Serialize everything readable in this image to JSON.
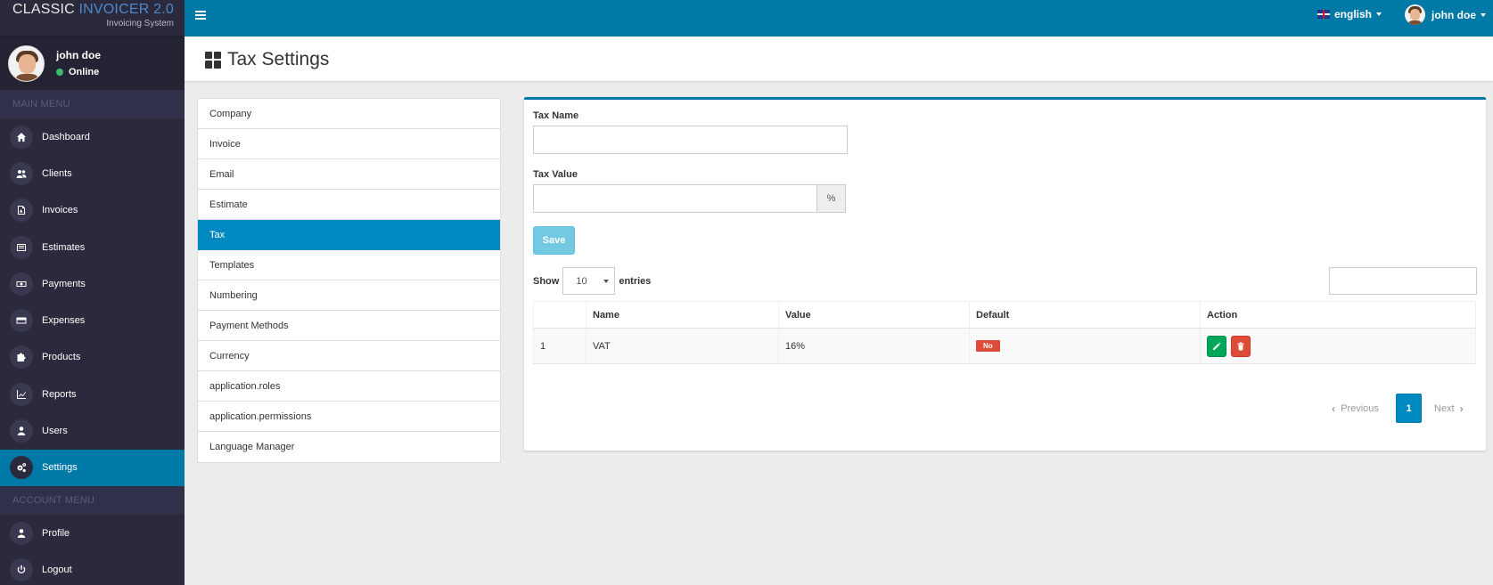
{
  "brand": {
    "title_plain": "CLASSIC ",
    "title_accent": "INVOICER 2.0",
    "subtitle": "Invoicing System"
  },
  "user": {
    "name": "john doe",
    "status": "Online"
  },
  "sidebar": {
    "main_menu_header": "MAIN MENU",
    "account_menu_header": "ACCOUNT MENU",
    "items": [
      {
        "label": "Dashboard",
        "icon": "home-icon"
      },
      {
        "label": "Clients",
        "icon": "users-icon"
      },
      {
        "label": "Invoices",
        "icon": "file-pdf-icon"
      },
      {
        "label": "Estimates",
        "icon": "list-icon"
      },
      {
        "label": "Payments",
        "icon": "money-icon"
      },
      {
        "label": "Expenses",
        "icon": "credit-card-icon"
      },
      {
        "label": "Products",
        "icon": "puzzle-icon"
      },
      {
        "label": "Reports",
        "icon": "line-chart-icon"
      },
      {
        "label": "Users",
        "icon": "user-icon"
      },
      {
        "label": "Settings",
        "icon": "cogs-icon",
        "active": true
      }
    ],
    "account_items": [
      {
        "label": "Profile",
        "icon": "user-icon"
      },
      {
        "label": "Logout",
        "icon": "power-icon"
      }
    ]
  },
  "topbar": {
    "language": "english",
    "user_name": "john doe"
  },
  "page": {
    "title": "Tax Settings"
  },
  "settings_menu": [
    "Company",
    "Invoice",
    "Email",
    "Estimate",
    "Tax",
    "Templates",
    "Numbering",
    "Payment Methods",
    "Currency",
    "application.roles",
    "application.permissions",
    "Language Manager"
  ],
  "settings_menu_active_index": 4,
  "form": {
    "tax_name_label": "Tax Name",
    "tax_name_value": "",
    "tax_value_label": "Tax Value",
    "tax_value_value": "",
    "percent_addon": "%",
    "save_label": "Save"
  },
  "table_controls": {
    "show_label": "Show",
    "entries_label": "entries",
    "page_length": "10",
    "search_value": ""
  },
  "table": {
    "columns": [
      "",
      "Name",
      "Value",
      "Default",
      "Action"
    ],
    "rows": [
      {
        "num": "1",
        "name": "VAT",
        "value": "16%",
        "default": "No"
      }
    ]
  },
  "pagination": {
    "previous": "Previous",
    "current": "1",
    "next": "Next"
  },
  "colors": {
    "primary": "#0079a6",
    "sidebar": "#2a2a3c",
    "success": "#00a65a",
    "danger": "#dd4b39",
    "info": "#5bc0de"
  }
}
